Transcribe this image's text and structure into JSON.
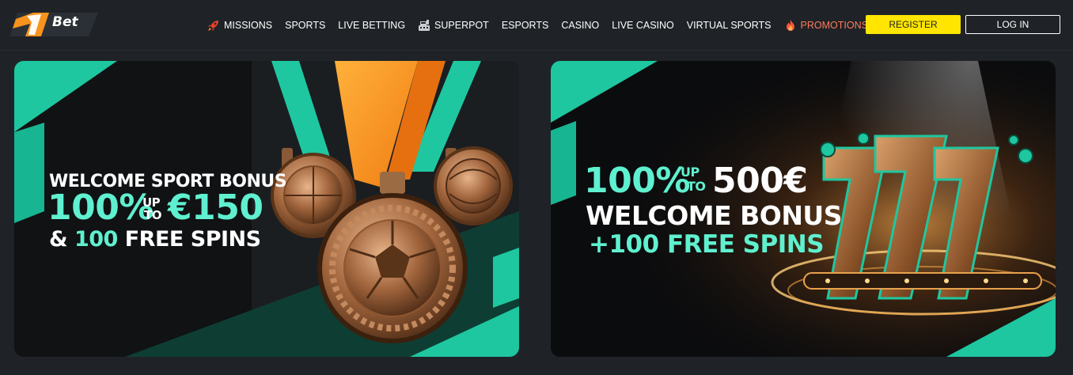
{
  "brand": {
    "logo_text": "Bet"
  },
  "nav": {
    "items": [
      {
        "label": "MISSIONS",
        "icon": "rocket-icon",
        "promo": false
      },
      {
        "label": "SPORTS",
        "icon": "",
        "promo": false
      },
      {
        "label": "LIVE BETTING",
        "icon": "",
        "promo": false
      },
      {
        "label": "SUPERPOT",
        "icon": "cash-register-icon",
        "promo": false
      },
      {
        "label": "ESPORTS",
        "icon": "",
        "promo": false
      },
      {
        "label": "CASINO",
        "icon": "",
        "promo": false
      },
      {
        "label": "LIVE CASINO",
        "icon": "",
        "promo": false
      },
      {
        "label": "VIRTUAL SPORTS",
        "icon": "",
        "promo": false
      },
      {
        "label": "PROMOTIONS",
        "icon": "fire-icon",
        "promo": true
      }
    ]
  },
  "auth": {
    "register_label": "REGISTER",
    "login_label": "LOG IN"
  },
  "banners": {
    "sport": {
      "line1": "WELCOME SPORT BONUS",
      "pct": "100%",
      "up": "UP",
      "to": "TO",
      "amount": "€150",
      "amp": "&",
      "spins_count": "100",
      "spins_text": "FREE SPINS"
    },
    "casino": {
      "pct": "100%",
      "up": "UP",
      "to": "TO",
      "amount": "500€",
      "line2": "WELCOME BONUS",
      "line3": "+100 FREE SPINS"
    }
  },
  "colors": {
    "accent_yellow": "#ffe500",
    "accent_teal": "#5ff0cf",
    "promo_orange": "#ff7a5c",
    "background": "#1f2327"
  }
}
